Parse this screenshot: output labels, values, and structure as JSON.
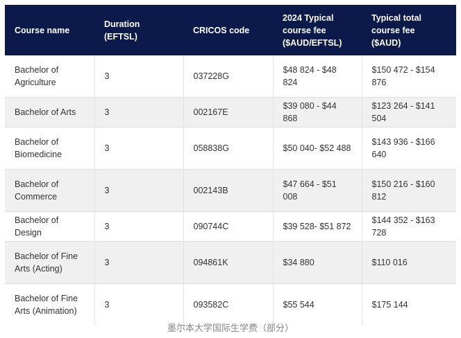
{
  "table": {
    "headers": [
      "Course name",
      "Duration (EFTSL)",
      "CRICOS code",
      "2024 Typical course fee ($AUD/EFTSL)",
      "Typical total course fee ($AUD)"
    ],
    "rows": [
      [
        "Bachelor of Agriculture",
        "3",
        "037228G",
        "$48 824 - $48 824",
        "$150 472 - $154 876"
      ],
      [
        "Bachelor of Arts",
        "3",
        "002167E",
        "$39 080 - $44 868",
        "$123 264 - $141 504"
      ],
      [
        "Bachelor of Biomedicine",
        "3",
        "058838G",
        "$50 040- $52 488",
        "$143 936 - $166 640"
      ],
      [
        "Bachelor of Commerce",
        "3",
        "002143B",
        "$47 664 - $51 008",
        "$150 216 - $160 812"
      ],
      [
        "Bachelor of Design",
        "3",
        "090744C",
        "$39 528- $51 872",
        "$144 352 - $163 728"
      ],
      [
        "Bachelor of Fine Arts (Acting)",
        "3",
        "094861K",
        "$34 880",
        "$110 016"
      ],
      [
        "Bachelor of Fine Arts (Animation)",
        "3",
        "093582C",
        "$55 544",
        "$175 144"
      ]
    ]
  },
  "caption": "墨尔本大学国际生学费（部分）"
}
